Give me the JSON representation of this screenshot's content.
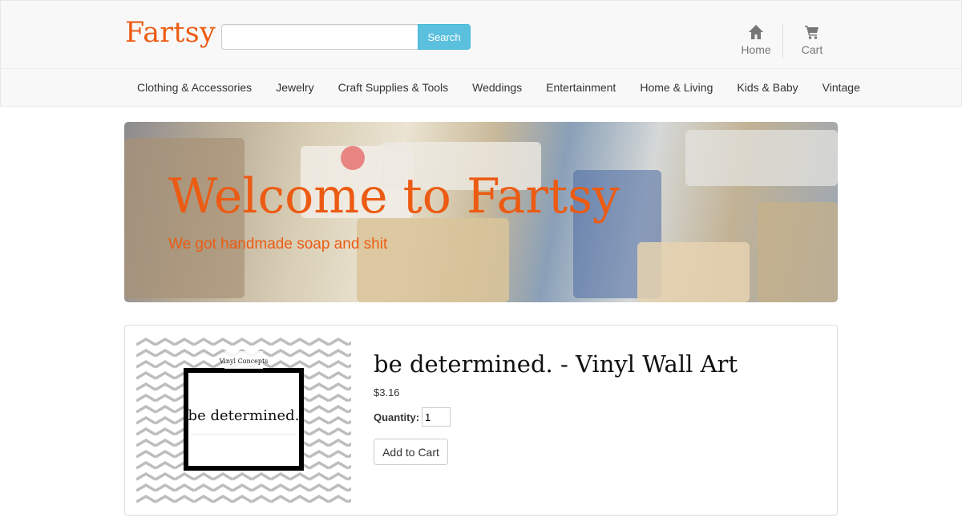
{
  "header": {
    "brand": "Fartsy",
    "search": {
      "value": "",
      "placeholder": "",
      "button_label": "Search"
    },
    "nav_right": [
      {
        "label": "Home",
        "icon": "home-icon"
      },
      {
        "label": "Cart",
        "icon": "cart-icon"
      }
    ]
  },
  "categories": [
    "Clothing & Accessories",
    "Jewelry",
    "Craft Supplies & Tools",
    "Weddings",
    "Entertainment",
    "Home & Living",
    "Kids & Baby",
    "Vintage"
  ],
  "hero": {
    "title": "Welcome to Fartsy",
    "subtitle": "We got handmade soap and shit"
  },
  "product": {
    "image_text": "be determined.",
    "image_logo_text": "Vinyl Concepts",
    "title": "be determined. - Vinyl Wall Art",
    "price": "$3.16",
    "quantity_label": "Quantity:",
    "quantity_value": "1",
    "add_to_cart_label": "Add to Cart"
  },
  "colors": {
    "brand": "#ec5b13",
    "search_button": "#5bc0de",
    "navbar_bg": "#f8f8f8",
    "muted_text": "#777777"
  }
}
